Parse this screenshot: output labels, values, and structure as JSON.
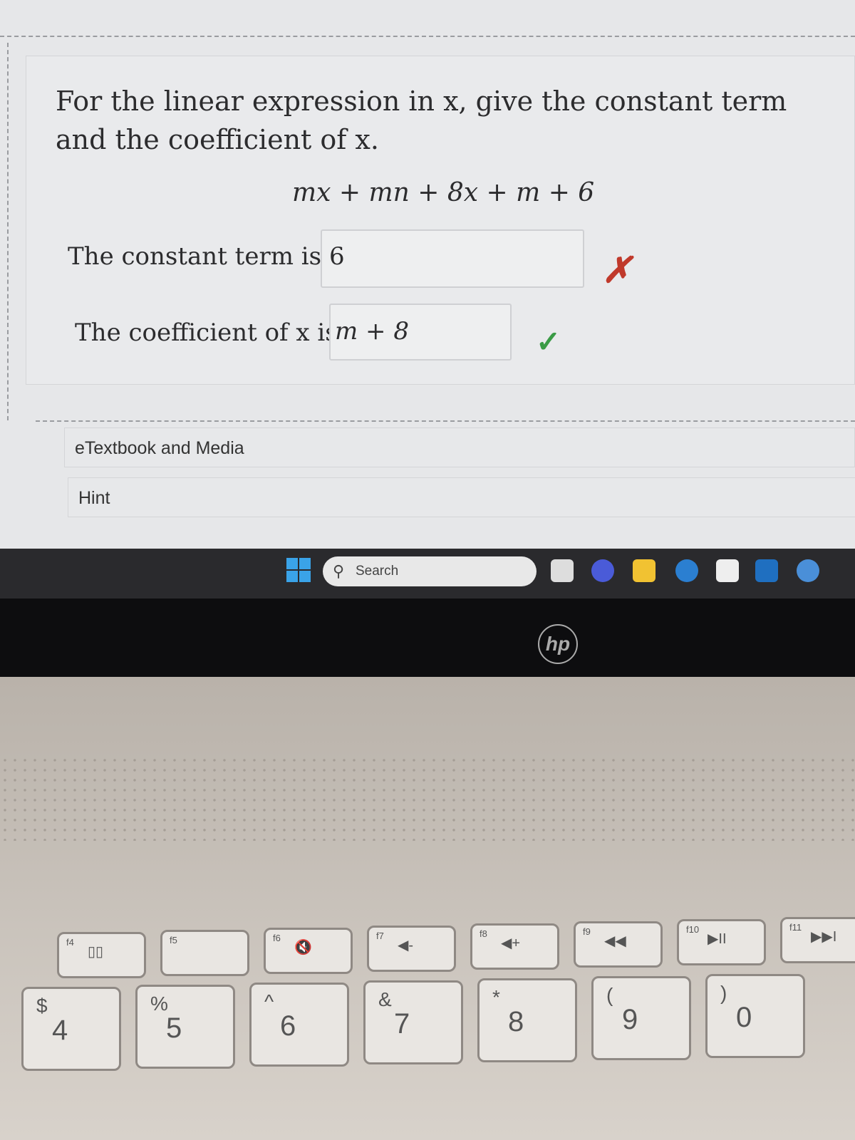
{
  "question": {
    "prompt": "For the linear expression in x, give the constant term and the coefficient of x.",
    "expression": "mx + mn + 8x + m + 6"
  },
  "answers": [
    {
      "label": "The constant term is",
      "value": "6",
      "status": "incorrect",
      "mark": "✗",
      "mark_color": "#c0392b"
    },
    {
      "label": "The coefficient of x is",
      "value": "m + 8",
      "status": "correct",
      "mark": "✓",
      "mark_color": "#3a9b45"
    }
  ],
  "sections": [
    "eTextbook and Media",
    "Hint"
  ],
  "taskbar": {
    "search_placeholder": "Search",
    "apps": [
      "task-view",
      "teams-meet",
      "file-explorer",
      "edge",
      "store",
      "myhp",
      "help"
    ]
  },
  "brand": "hp",
  "keys": {
    "function": [
      {
        "f": "f4",
        "icon": "▯▯"
      },
      {
        "f": "f5",
        "icon": ""
      },
      {
        "f": "f6",
        "icon": "🔇"
      },
      {
        "f": "f7",
        "icon": "◀-"
      },
      {
        "f": "f8",
        "icon": "◀+"
      },
      {
        "f": "f9",
        "icon": "◀◀"
      },
      {
        "f": "f10",
        "icon": "▶II"
      },
      {
        "f": "f11",
        "icon": "▶▶I"
      }
    ],
    "number": [
      {
        "s": "$",
        "m": "4"
      },
      {
        "s": "%",
        "m": "5"
      },
      {
        "s": "^",
        "m": "6"
      },
      {
        "s": "&",
        "m": "7"
      },
      {
        "s": "*",
        "m": "8"
      },
      {
        "s": "(",
        "m": "9"
      },
      {
        "s": ")",
        "m": "0"
      }
    ]
  }
}
